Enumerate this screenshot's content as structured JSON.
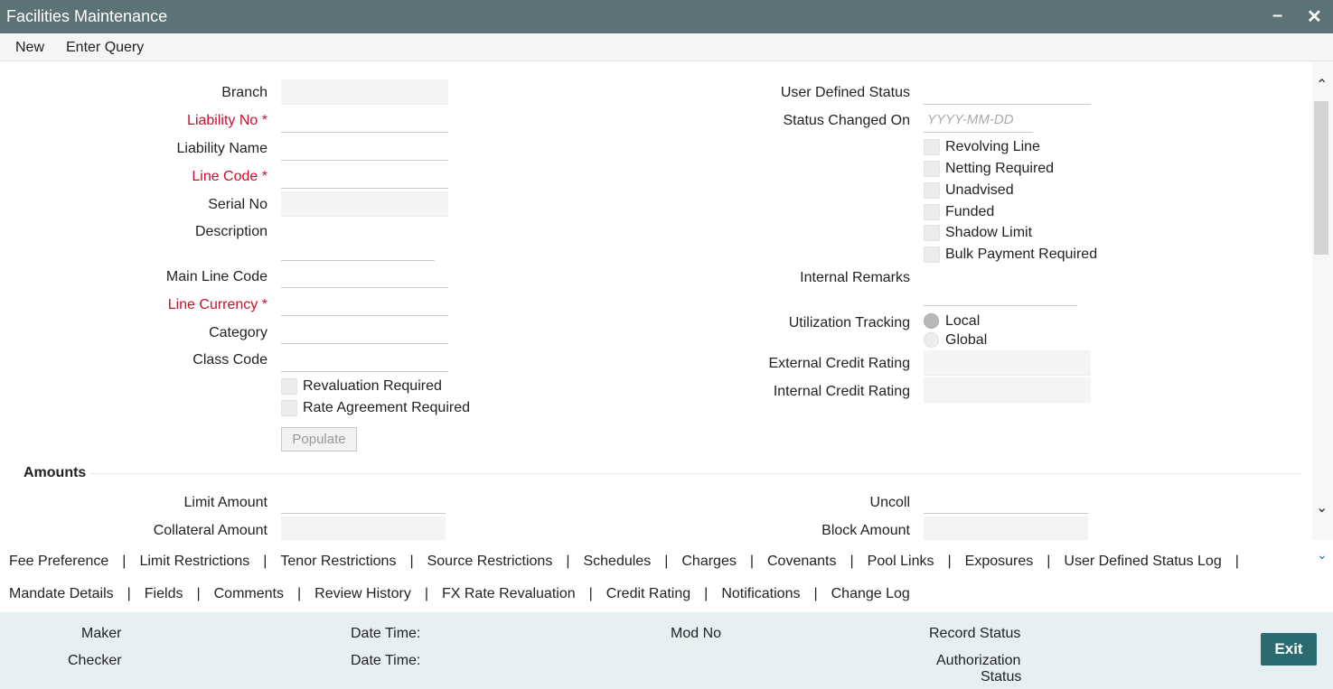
{
  "window": {
    "title": "Facilities Maintenance"
  },
  "menu": {
    "new": "New",
    "enter_query": "Enter Query"
  },
  "left_fields": {
    "branch": "Branch",
    "liability_no": "Liability No",
    "liability_name": "Liability Name",
    "line_code": "Line Code",
    "serial_no": "Serial No",
    "description": "Description",
    "main_line_code": "Main Line Code",
    "line_currency": "Line Currency",
    "category": "Category",
    "class_code": "Class Code",
    "required_mark": "*"
  },
  "left_checks": {
    "revaluation_required": "Revaluation Required",
    "rate_agreement_required": "Rate Agreement Required"
  },
  "populate_button": "Populate",
  "right_fields": {
    "user_defined_status": "User Defined Status",
    "status_changed_on": "Status Changed On",
    "status_changed_on_placeholder": "YYYY-MM-DD",
    "internal_remarks": "Internal Remarks",
    "utilization_tracking": "Utilization Tracking",
    "external_credit_rating": "External Credit Rating",
    "internal_credit_rating": "Internal Credit Rating"
  },
  "right_checks": {
    "revolving_line": "Revolving Line",
    "netting_required": "Netting Required",
    "unadvised": "Unadvised",
    "funded": "Funded",
    "shadow_limit": "Shadow Limit",
    "bulk_payment_required": "Bulk Payment Required"
  },
  "utilization_options": {
    "local": "Local",
    "global": "Global",
    "selected": "Local"
  },
  "amounts": {
    "section_title": "Amounts",
    "limit_amount": "Limit Amount",
    "collateral_amount": "Collateral Amount",
    "uncoll": "Uncoll",
    "block_amount": "Block Amount"
  },
  "tabs_row1": [
    "Fee Preference",
    "Limit Restrictions",
    "Tenor Restrictions",
    "Source Restrictions",
    "Schedules",
    "Charges",
    "Covenants",
    "Pool Links",
    "Exposures",
    "User Defined Status Log"
  ],
  "tabs_row2": [
    "Mandate Details",
    "Fields",
    "Comments",
    "Review History",
    "FX Rate Revaluation",
    "Credit Rating",
    "Notifications",
    "Change Log"
  ],
  "tab_separator": "|",
  "footer": {
    "maker": "Maker",
    "checker": "Checker",
    "date_time_1": "Date Time:",
    "date_time_2": "Date Time:",
    "mod_no": "Mod No",
    "record_status": "Record Status",
    "authorization": "Authorization",
    "status": "Status",
    "exit": "Exit"
  },
  "icons": {
    "minimize": "minimize-icon",
    "close": "close-icon",
    "scroll_up": "chevron-up-icon",
    "scroll_down": "chevron-down-icon",
    "more_tabs": "chevron-down-icon"
  },
  "colors": {
    "titlebar": "#5c7277",
    "required": "#c8102e",
    "footer": "#e6f0f2",
    "exit": "#2a6b72"
  }
}
